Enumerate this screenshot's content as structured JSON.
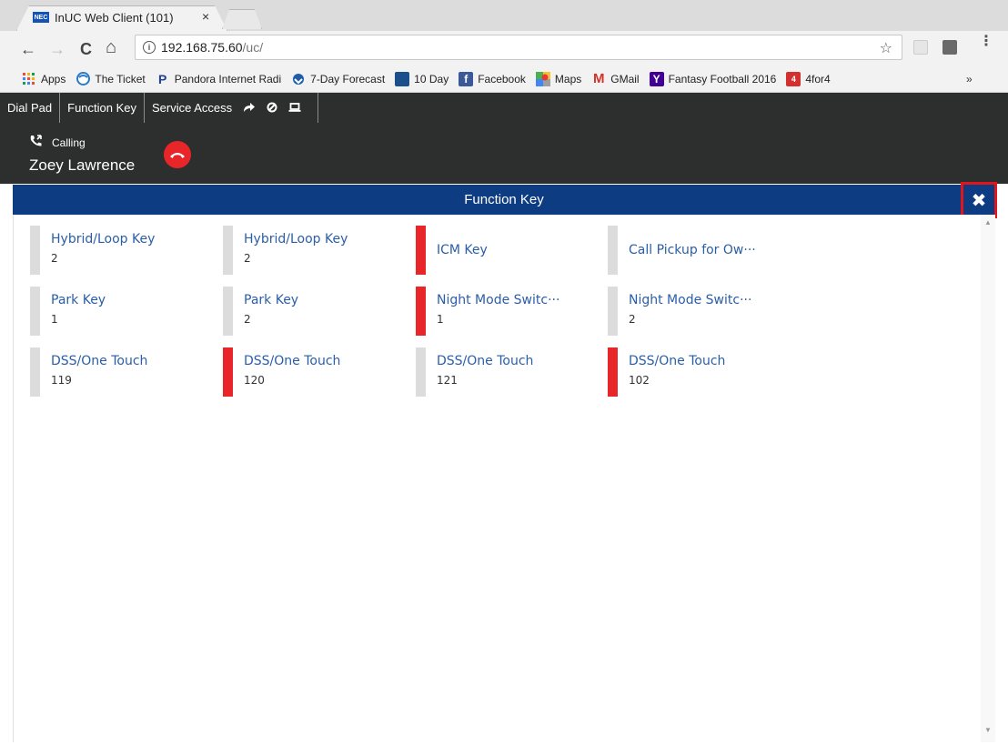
{
  "browser": {
    "tab_title": "InUC Web Client (101)",
    "tab_close": "×",
    "favicon_text": "NEC",
    "url_host": "192.168.75.60",
    "url_path": "/uc/",
    "info_glyph": "i",
    "star": "☆",
    "menu": "⋮",
    "nav": {
      "back": "←",
      "forward": "→",
      "reload": "C",
      "home": "⌂"
    },
    "bookmarks": [
      {
        "label": "Apps",
        "icon": "apps-icon"
      },
      {
        "label": "The Ticket",
        "icon": "ticket-icon"
      },
      {
        "label": "Pandora Internet Radi",
        "icon": "pandora-icon"
      },
      {
        "label": "7-Day Forecast",
        "icon": "weather-icon"
      },
      {
        "label": "10 Day",
        "icon": "weather-channel-icon"
      },
      {
        "label": "Facebook",
        "icon": "facebook-icon"
      },
      {
        "label": "Maps",
        "icon": "maps-icon"
      },
      {
        "label": "GMail",
        "icon": "gmail-icon"
      },
      {
        "label": "Fantasy Football 2016",
        "icon": "yahoo-icon"
      },
      {
        "label": "4for4",
        "icon": "4for4-icon"
      }
    ],
    "bookmarks_more": "»"
  },
  "app": {
    "nav": {
      "dial_pad": "Dial Pad",
      "function_key": "Function Key",
      "service_access": "Service Access"
    },
    "call": {
      "status": "Calling",
      "caller": "Zoey Lawrence"
    },
    "function_key_panel": {
      "title": "Function Key",
      "close": "✖",
      "keys": [
        {
          "label": "Hybrid/Loop Key",
          "number": "2",
          "active": false
        },
        {
          "label": "Hybrid/Loop Key",
          "number": "2",
          "active": false
        },
        {
          "label": "ICM Key",
          "number": "",
          "active": true
        },
        {
          "label": "Call Pickup for Ow···",
          "number": "",
          "active": false
        },
        {
          "label": "Park Key",
          "number": "1",
          "active": false
        },
        {
          "label": "Park Key",
          "number": "2",
          "active": false
        },
        {
          "label": "Night Mode Switc···",
          "number": "1",
          "active": true
        },
        {
          "label": "Night Mode Switc···",
          "number": "2",
          "active": false
        },
        {
          "label": "DSS/One Touch",
          "number": "119",
          "active": false
        },
        {
          "label": "DSS/One Touch",
          "number": "120",
          "active": true
        },
        {
          "label": "DSS/One Touch",
          "number": "121",
          "active": false
        },
        {
          "label": "DSS/One Touch",
          "number": "102",
          "active": true
        }
      ]
    }
  },
  "colors": {
    "nav_bg": "#2d2f2e",
    "header_bg": "#0d3c82",
    "active_bar": "#e8262a",
    "inactive_bar": "#dcdcdc",
    "key_label": "#2a5ea8"
  }
}
